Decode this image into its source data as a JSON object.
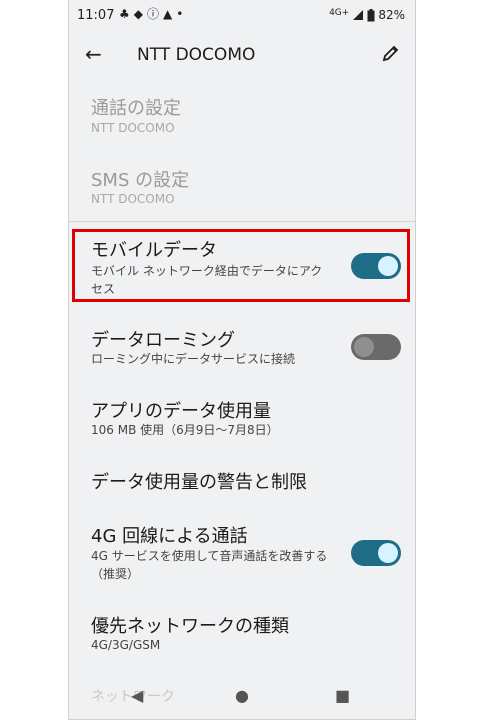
{
  "status": {
    "time": "11:07",
    "icons": [
      "notification-icon-1",
      "notification-icon-2",
      "info-icon",
      "warning-icon",
      "dot-icon"
    ],
    "network": "4G+",
    "battery": "82%"
  },
  "appbar": {
    "title": "NTT DOCOMO",
    "back_icon": "arrow-back-icon",
    "edit_icon": "pencil-icon"
  },
  "settings": {
    "call": {
      "title": "通話の設定",
      "subtitle": "NTT DOCOMO"
    },
    "sms": {
      "title": "SMS の設定",
      "subtitle": "NTT DOCOMO"
    },
    "mobile_data": {
      "title": "モバイルデータ",
      "subtitle_line1": "モバイル ネットワーク経由でデータにアク",
      "subtitle_line2": "セス",
      "enabled": true
    },
    "roaming": {
      "title": "データローミング",
      "subtitle": "ローミング中にデータサービスに接続",
      "enabled": false
    },
    "app_data_usage": {
      "title": "アプリのデータ使用量",
      "subtitle": "106 MB 使用（6月9日〜7月8日）"
    },
    "data_warning": {
      "title": "データ使用量の警告と制限"
    },
    "volte": {
      "title": "4G 回線による通話",
      "subtitle_line1": "4G サービスを使用して音声通話を改善する",
      "subtitle_line2": "（推奨）",
      "enabled": true
    },
    "network_type": {
      "title": "優先ネットワークの種類",
      "subtitle": "4G/3G/GSM"
    },
    "next_partial": "ネットワーク"
  },
  "colors": {
    "toggle_on": "#1f6c87",
    "toggle_off": "#6a6a6a",
    "highlight": "#e00000"
  }
}
